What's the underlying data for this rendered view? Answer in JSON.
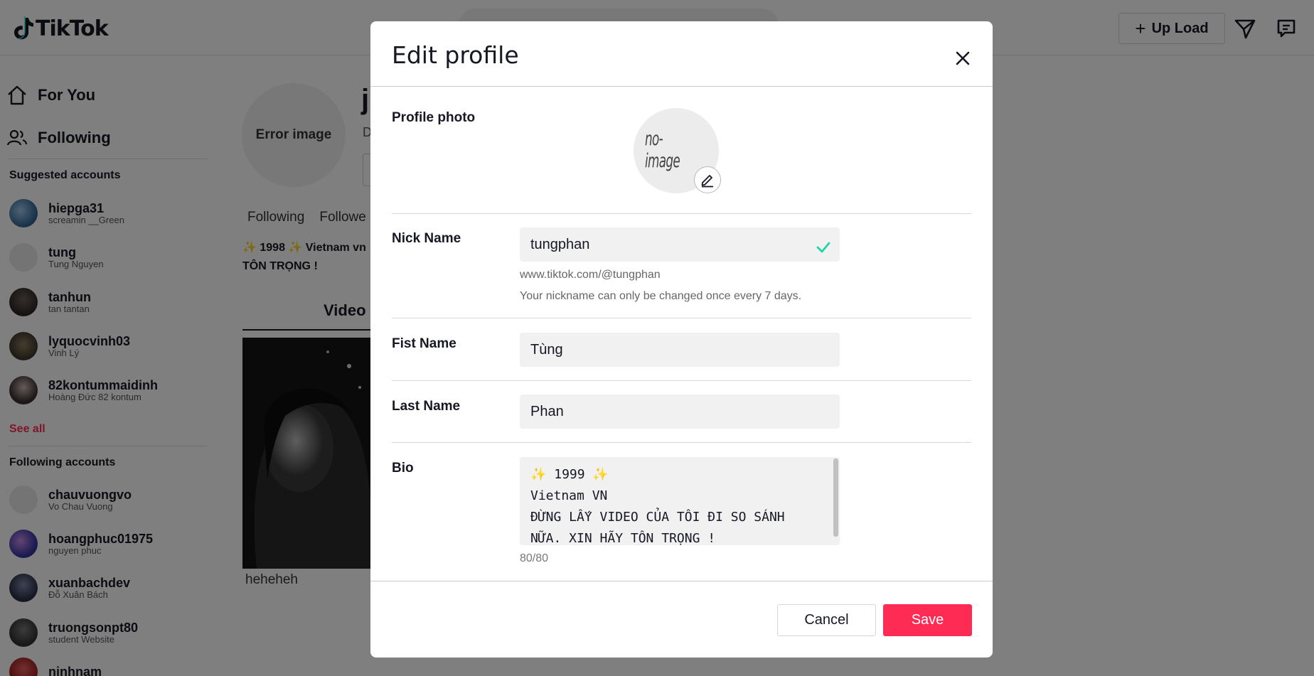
{
  "header": {
    "logo_text": "TikTok",
    "upload_plus": "+",
    "upload_label": "Up Load"
  },
  "sidebar": {
    "nav": [
      {
        "label": "For You",
        "icon": "home-icon"
      },
      {
        "label": "Following",
        "icon": "users-icon"
      }
    ],
    "suggested_title": "Suggested accounts",
    "suggested": [
      {
        "username": "hiepga31",
        "display": "screamin __Green"
      },
      {
        "username": "tung",
        "display": "Tung Nguyen"
      },
      {
        "username": "tanhun",
        "display": "tan tantan"
      },
      {
        "username": "lyquocvinh03",
        "display": "Vinh Lý"
      },
      {
        "username": "82kontummaidinh",
        "display": "Hoàng Đức 82 kontum"
      }
    ],
    "see_all": "See all",
    "following_title": "Following accounts",
    "following": [
      {
        "username": "chauvuongvo",
        "display": "Vo Chau Vuong"
      },
      {
        "username": "hoangphuc01975",
        "display": "nguyen phuc"
      },
      {
        "username": "xuanbachdev",
        "display": "Đỗ Xuân Bách"
      },
      {
        "username": "truongsonpt80",
        "display": "student Website"
      },
      {
        "username": "ninhnam",
        "display": ""
      }
    ]
  },
  "profile": {
    "avatar_text": "Error image",
    "name_fragment": "j",
    "sub_fragment": "D",
    "stats": "Following    Followe",
    "bio_line1": "✨ 1998 ✨ Vietnam vn",
    "bio_line2": "TÔN TRỌNG !",
    "tab_video": "Video",
    "video_caption": "heheheh"
  },
  "modal": {
    "title": "Edit profile",
    "profile_photo_label": "Profile photo",
    "photo_placeholder": "no-image",
    "nickname_label": "Nick Name",
    "nickname_value": "tungphan",
    "profile_url": "www.tiktok.com/@tungphan",
    "nickname_hint": "Your nickname can only be changed once every 7 days.",
    "firstname_label": "Fist Name",
    "firstname_value": "Tùng",
    "lastname_label": "Last Name",
    "lastname_value": "Phan",
    "bio_label": "Bio",
    "bio_value": "✨ 1999 ✨\nVietnam VN\nĐỪNG LẤY VIDEO CỦA TÔI ĐI SO SÁNH NỮA. XIN HÃY TÔN TRỌNG !",
    "bio_counter": "80/80",
    "cancel_label": "Cancel",
    "save_label": "Save"
  },
  "colors": {
    "accent": "#fe2c55",
    "check": "#20d5a4",
    "overlay": "rgba(0,0,0,0.5)"
  }
}
